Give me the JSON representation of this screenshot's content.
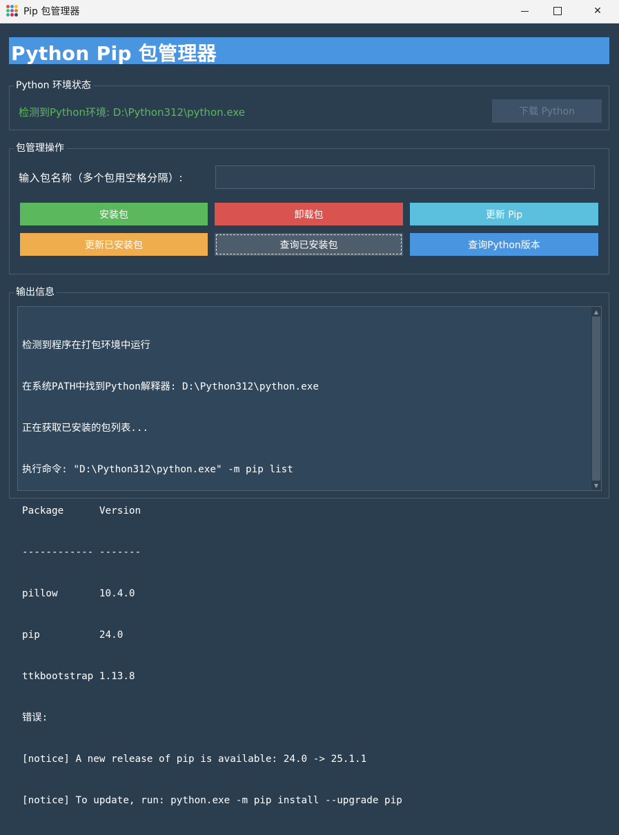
{
  "window": {
    "title": "Pip 包管理器",
    "min_icon": "minimize-icon",
    "max_icon": "maximize-icon",
    "close_icon": "close-icon",
    "close_glyph": "✕"
  },
  "header": {
    "title": "Python Pip 包管理器"
  },
  "env": {
    "group_label": "Python 环境状态",
    "status": "检测到Python环境: D:\\Python312\\python.exe",
    "download_button": "下载 Python"
  },
  "pkg": {
    "group_label": "包管理操作",
    "input_label": "输入包名称（多个包用空格分隔）:",
    "input_value": "",
    "buttons": {
      "install": "安装包",
      "uninstall": "卸载包",
      "upgrade_pip": "更新 Pip",
      "update_all": "更新已安装包",
      "query": "查询已安装包",
      "python_version": "查询Python版本"
    }
  },
  "output": {
    "group_label": "输出信息",
    "lines": [
      "检测到程序在打包环境中运行",
      "在系统PATH中找到Python解释器: D:\\Python312\\python.exe",
      "正在获取已安装的包列表...",
      "执行命令: \"D:\\Python312\\python.exe\" -m pip list",
      "Package      Version",
      "------------ -------",
      "pillow       10.4.0",
      "pip          24.0",
      "ttkbootstrap 1.13.8",
      "错误:",
      "[notice] A new release of pip is available: 24.0 -> 25.1.1",
      "[notice] To update, run: python.exe -m pip install --upgrade pip"
    ]
  },
  "colors": {
    "background": "#2b3e50",
    "primary": "#4a95e0",
    "success": "#5cb85c",
    "danger": "#d9534f",
    "info": "#5bc0de",
    "warning": "#f0ad4e",
    "secondary": "#4e5d6c"
  }
}
